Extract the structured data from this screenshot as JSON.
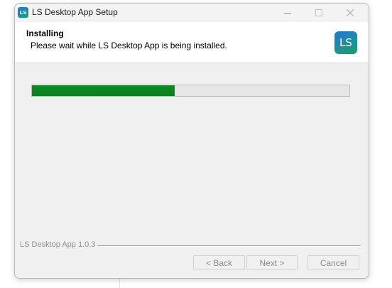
{
  "window": {
    "title": "LS Desktop App Setup",
    "app_icon_text": "LS"
  },
  "header": {
    "title": "Installing",
    "subtitle": "Please wait while LS Desktop App is being installed.",
    "logo_text": "LS"
  },
  "progress": {
    "value": 0.45,
    "color": "#0b7d1f"
  },
  "footer": {
    "brand": "LS Desktop App 1.0.3"
  },
  "buttons": {
    "back": "< Back",
    "next": "Next >",
    "cancel": "Cancel"
  }
}
